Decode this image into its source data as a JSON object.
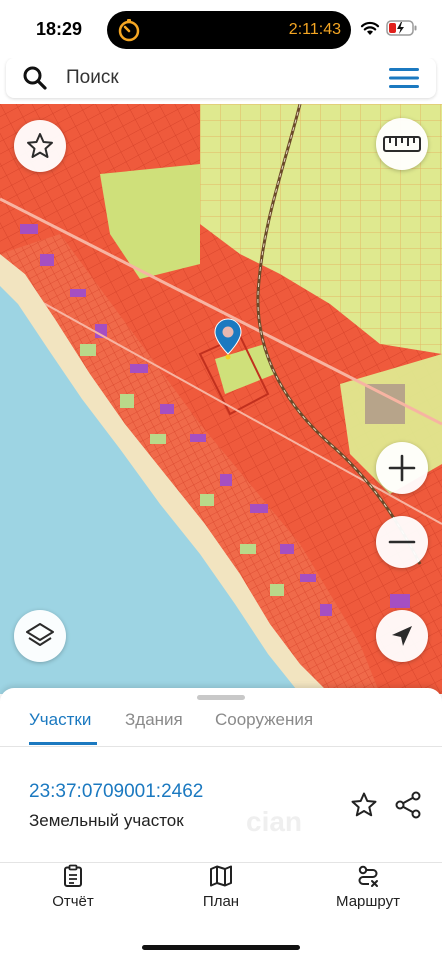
{
  "status_bar": {
    "time": "18:29",
    "timer": "2:11:43",
    "timer_color": "#f5a623",
    "icons": [
      "stopwatch-icon",
      "wifi-icon",
      "battery-charging-icon"
    ]
  },
  "search": {
    "placeholder": "Поиск",
    "icon": "search-icon",
    "menu_icon": "hamburger-menu-icon"
  },
  "map": {
    "controls": [
      "favorite-star-icon",
      "ruler-icon",
      "zoom-in-icon",
      "zoom-out-icon",
      "layers-icon",
      "locate-arrow-icon"
    ],
    "marker": "location-pin-icon",
    "colors": {
      "sea": "#9dd4e3",
      "beach": "#f2e4c0",
      "built_parcels": "#ef5a3c",
      "parcel_outline": "#d8452c",
      "agricultural": "#d8e48a",
      "accent_purple": "#a54fc2",
      "railway": "#6b4a2a",
      "pin": "#1b79c0"
    }
  },
  "sheet": {
    "tabs": [
      {
        "label": "Участки",
        "active": true
      },
      {
        "label": "Здания",
        "active": false
      },
      {
        "label": "Сооружения",
        "active": false
      }
    ],
    "parcel": {
      "cadastral_number": "23:37:0709001:2462",
      "type": "Земельный участок",
      "watermark": "cian",
      "icons": [
        "star-outline-icon",
        "share-icon"
      ]
    },
    "accent_color": "#1b79c0"
  },
  "bottom_nav": {
    "items": [
      {
        "label": "Отчёт",
        "icon": "report-clipboard-icon"
      },
      {
        "label": "План",
        "icon": "map-plan-icon"
      },
      {
        "label": "Маршрут",
        "icon": "route-icon"
      }
    ]
  }
}
